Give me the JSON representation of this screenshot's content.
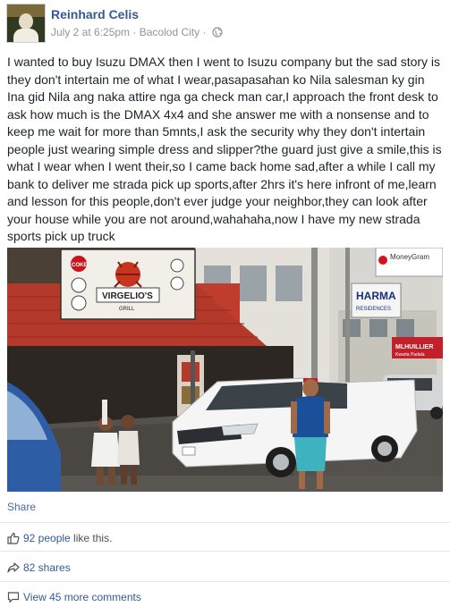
{
  "post": {
    "author": "Reinhard Celis",
    "avatar_text": "",
    "date": "July 2 at 6:25pm",
    "separator": "·",
    "location": "Bacolod City",
    "separator2": "·",
    "privacy_icon": "globe-icon",
    "text": "I wanted to buy Isuzu DMAX then I went to Isuzu company but the sad story is they don't intertain me of what I wear,pasapasahan ko Nila salesman ky gin Ina gid Nila ang naka attire nga ga check man car,I approach the front desk to ask how much is the DMAX 4x4 and she answer me with a nonsense and to keep me wait for more than 5mnts,I ask the security why they don't intertain people just wearing simple dress and slipper?the guard just give a smile,this is what I wear when I went their,so I came back home sad,after a while I call my bank to deliver me strada pick up sports,after 2hrs it's here infront of me,learn and lesson for this people,don't ever judge your neighbor,they can look after your house while you are not around,wahahaha,now I have my new strada sports pick up truck"
  },
  "photo": {
    "signs": {
      "restaurant_name": "VIRGELIO'S",
      "restaurant_sub": "GRILL",
      "coke": "COKE",
      "moneygram": "MoneyGram",
      "pharma": "HARMA",
      "pharma_sub": "RESIDENCES",
      "mlhuillier": "MLHUILLIER",
      "mlhuillier_sub": "Kwarta Padala"
    }
  },
  "actions": {
    "share_label": "Share"
  },
  "stats": {
    "likes_count": "92 people",
    "likes_suffix": " like this.",
    "shares": "82 shares",
    "comments": "View 45 more comments"
  },
  "colors": {
    "link": "#365899",
    "meta": "#90949c",
    "text": "#1d2129",
    "divider": "#e5e6e9"
  }
}
